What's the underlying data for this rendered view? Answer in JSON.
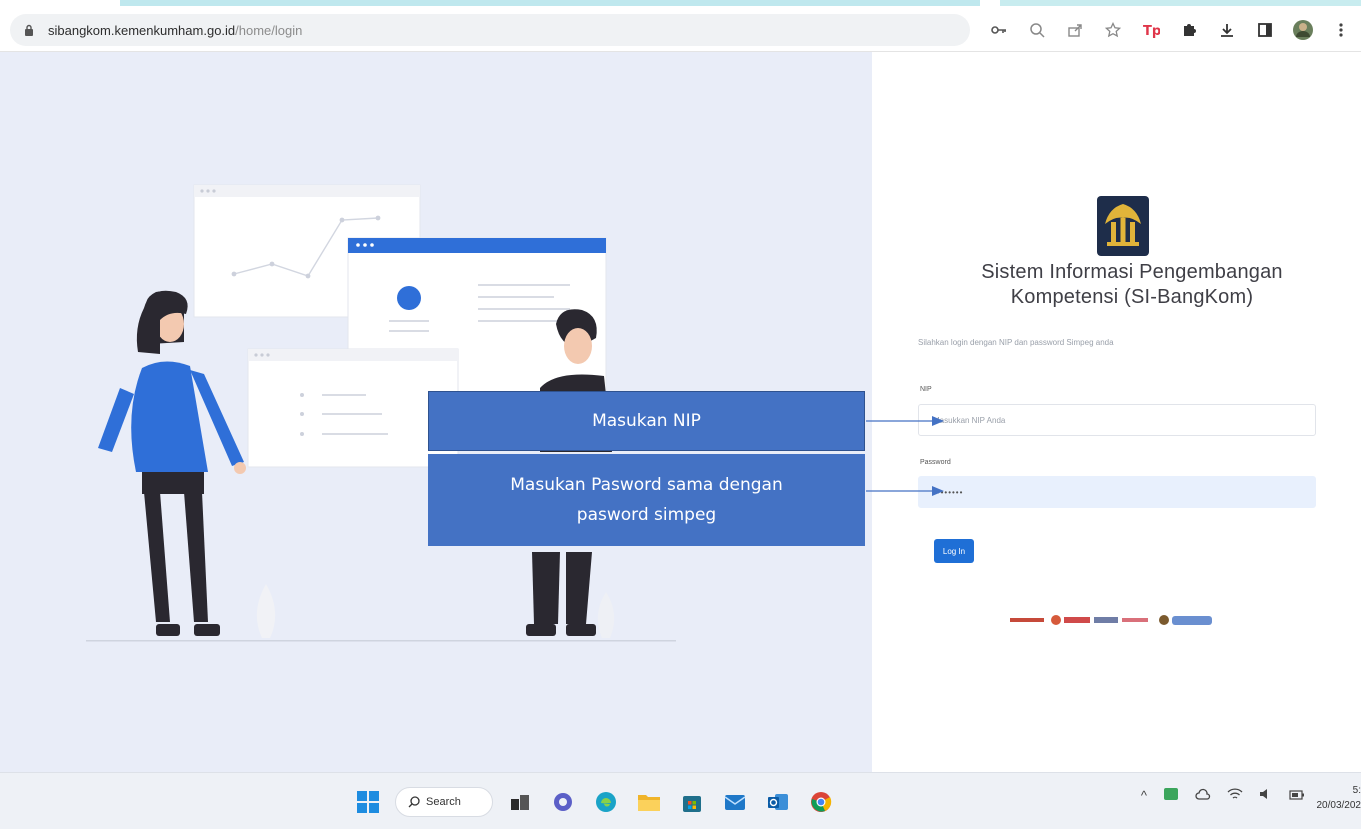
{
  "browser": {
    "url_host": "sibangkom.kemenkumham.go.id",
    "url_path": "/home/login",
    "toolbar_icons": [
      "key-icon",
      "zoom-icon",
      "share-icon",
      "star-icon",
      "extension-tp-icon",
      "puzzle-icon",
      "download-icon",
      "sidepanel-icon",
      "profile-avatar-icon",
      "menu-icon"
    ]
  },
  "login": {
    "app_title_line1": "Sistem Informasi Pengembangan",
    "app_title_line2": "Kompetensi (SI-BangKom)",
    "subtitle": "Silahkan login dengan NIP dan password Simpeg anda",
    "nip_label": "NIP",
    "nip_placeholder": "Masukkan NIP Anda",
    "password_label": "Password",
    "password_value": "••••••••",
    "login_button": "Log In"
  },
  "annotations": {
    "nip": "Masukan NIP",
    "password_line1": "Masukan Pasword sama dengan",
    "password_line2": "pasword simpeg"
  },
  "taskbar": {
    "search_label": "Search",
    "clock_time": "5:",
    "clock_date": "20/03/202"
  },
  "colors": {
    "illustration_bg": "#e9edf8",
    "accent_blue": "#1f6fd6",
    "callout_blue": "#4472c4"
  }
}
